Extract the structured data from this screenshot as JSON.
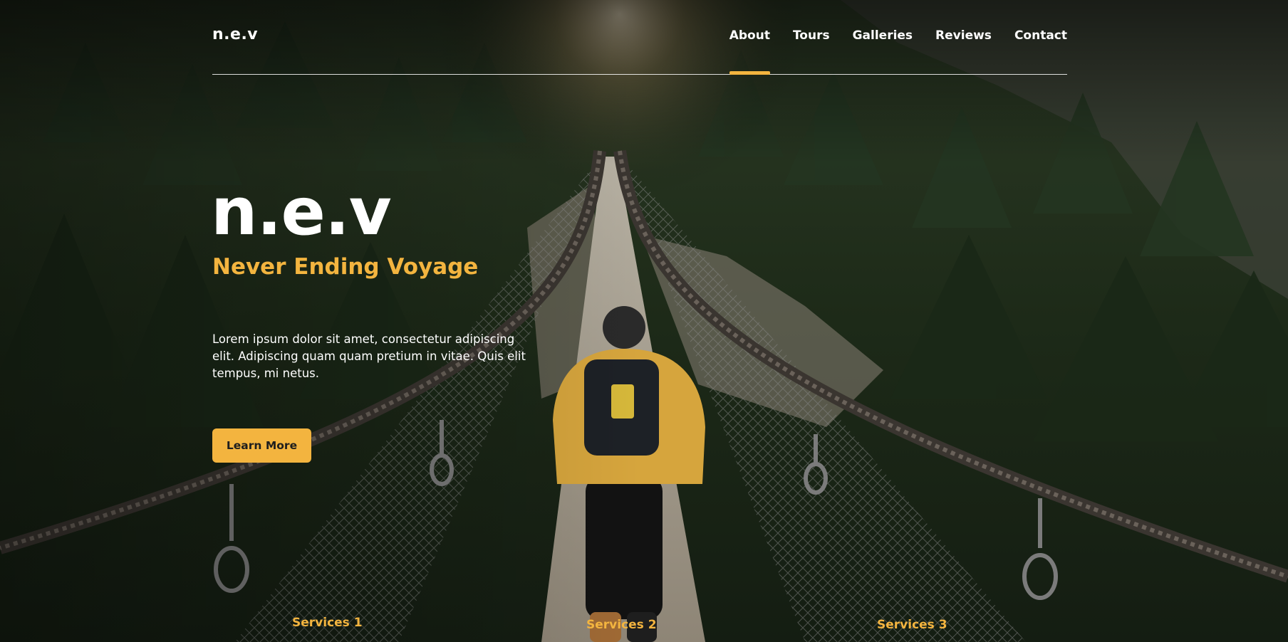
{
  "header": {
    "logo": "n.e.v",
    "nav": [
      {
        "label": "About",
        "active": true
      },
      {
        "label": "Tours",
        "active": false
      },
      {
        "label": "Galleries",
        "active": false
      },
      {
        "label": "Reviews",
        "active": false
      },
      {
        "label": "Contact",
        "active": false
      }
    ]
  },
  "hero": {
    "title": "n.e.v",
    "tagline": "Never Ending Voyage",
    "description": "Lorem ipsum dolor sit amet, consectetur adipiscing elit. Adipiscing quam quam pretium in vitae. Quis elit tempus, mi netus.",
    "cta_label": "Learn More",
    "background_image": "hiker in yellow hoodie walking across a suspension bridge through a forest"
  },
  "services": [
    {
      "label": "Services 1"
    },
    {
      "label": "Services 2"
    },
    {
      "label": "Services 3"
    }
  ],
  "colors": {
    "accent": "#f3b43f",
    "text_light": "#ffffff",
    "button_text": "#1e1e1e"
  }
}
